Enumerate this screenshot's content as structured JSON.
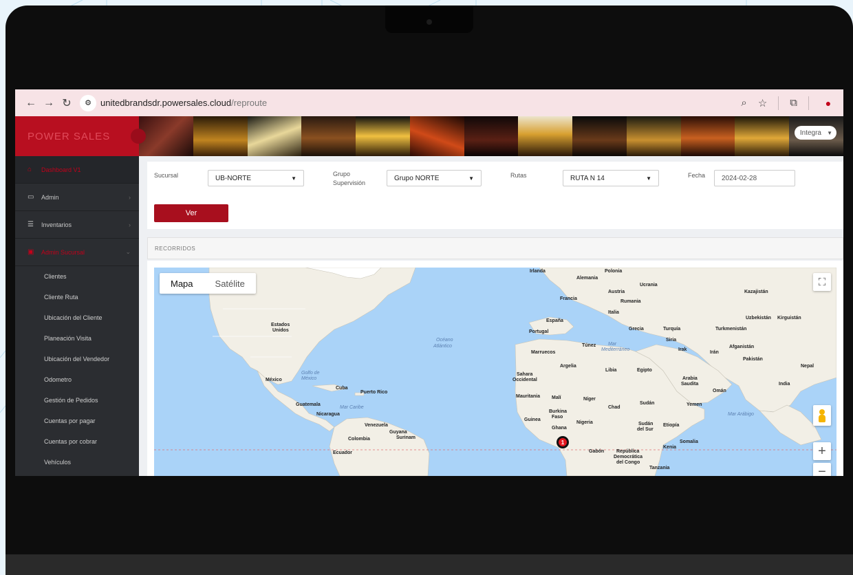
{
  "browser": {
    "url_domain": "unitedbrandsdr.powersales.cloud",
    "url_path": "/reproute",
    "icons": [
      "back-arrow-icon",
      "forward-arrow-icon",
      "reload-icon",
      "site-settings-icon",
      "zoom-icon",
      "star-icon",
      "extensions-icon",
      "profile-icon"
    ]
  },
  "app": {
    "brand": "POWER SALES",
    "user_menu": "Integra"
  },
  "sidebar": {
    "sections": [
      {
        "label": "Dashboard V1",
        "icon": "dashboard-icon",
        "active": true
      },
      {
        "label": "Admin",
        "icon": "laptop-icon"
      },
      {
        "label": "Inventarios",
        "icon": "list-icon"
      },
      {
        "label": "Admin Sucursal",
        "icon": "monitor-icon",
        "active": true
      }
    ],
    "items": [
      "Clientes",
      "Cliente Ruta",
      "Ubicación del Cliente",
      "Planeación Visita",
      "Ubicación del Vendedor",
      "Odometro",
      "Gestión de Pedidos",
      "Cuentas por pagar",
      "Cuentas por cobrar",
      "Vehículos"
    ]
  },
  "filters": {
    "sucursal_label": "Sucursal",
    "sucursal_value": "UB-NORTE",
    "grupo_label_1": "Grupo",
    "grupo_label_2": "Supervisión",
    "grupo_value": "Grupo NORTE",
    "rutas_label": "Rutas",
    "rutas_value": "RUTA N 14",
    "fecha_label": "Fecha",
    "fecha_value": "2024-02-28",
    "ver_button": "Ver"
  },
  "recorridos": {
    "header": "RECORRIDOS"
  },
  "map": {
    "tab_map": "Mapa",
    "tab_satellite": "Satélite",
    "zoom_in": "+",
    "zoom_out": "−",
    "marker_label": "1",
    "labels": {
      "irlanda": "Irlanda",
      "polonia": "Polonia",
      "alemania": "Alemania",
      "ucrania": "Ucrania",
      "francia": "Francia",
      "austria": "Austria",
      "rumania": "Rumania",
      "kazajistan": "Kazajistán",
      "italia": "Italia",
      "uzbekistan": "Uzbekistán",
      "kirguistan": "Kirguistán",
      "espana": "España",
      "portugal": "Portugal",
      "grecia": "Grecia",
      "turquia": "Turquía",
      "turkmenistan": "Turkmenistán",
      "estados_unidos_1": "Estados",
      "estados_unidos_2": "Unidos",
      "oceano_1": "Océano",
      "oceano_2": "Atlántico",
      "tunez": "Túnez",
      "mar_med_1": "Mar",
      "mar_med_2": "Mediterráneo",
      "siria": "Siria",
      "irak": "Irak",
      "iran": "Irán",
      "afganistan": "Afganistán",
      "pakistan": "Pakistán",
      "marruecos": "Marruecos",
      "nepal": "Nepal",
      "argelia": "Argelia",
      "libia": "Libia",
      "egipto": "Egipto",
      "sahara_1": "Sahara",
      "sahara_2": "Occidental",
      "golfo_1": "Golfo de",
      "golfo_2": "México",
      "mexico": "México",
      "arabia_1": "Arabia",
      "arabia_2": "Saudita",
      "oman": "Omán",
      "india": "India",
      "cuba": "Cuba",
      "puerto_rico": "Puerto Rico",
      "mauritania": "Mauritania",
      "mali": "Malí",
      "niger": "Níger",
      "chad": "Chad",
      "sudan": "Sudán",
      "yemen": "Yemen",
      "guatemala": "Guatemala",
      "mar_caribe": "Mar Caribe",
      "burkina_1": "Burkina",
      "burkina_2": "Faso",
      "nicaragua": "Nicaragua",
      "guinea": "Guinea",
      "nigeria": "Nigeria",
      "mar_arabigo": "Mar Arábigo",
      "venezuela": "Venezuela",
      "guyana": "Guyana",
      "surinam": "Surinam",
      "ghana": "Ghana",
      "sudan_sur_1": "Sudán",
      "sudan_sur_2": "del Sur",
      "etiopia": "Etiopía",
      "colombia": "Colombia",
      "somalia": "Somalia",
      "ecuador": "Ecuador",
      "gabon": "Gabón",
      "rep_1": "República",
      "rep_2": "Democrática",
      "rep_3": "del Congo",
      "kenia": "Kenia",
      "tanzania": "Tanzania"
    }
  }
}
